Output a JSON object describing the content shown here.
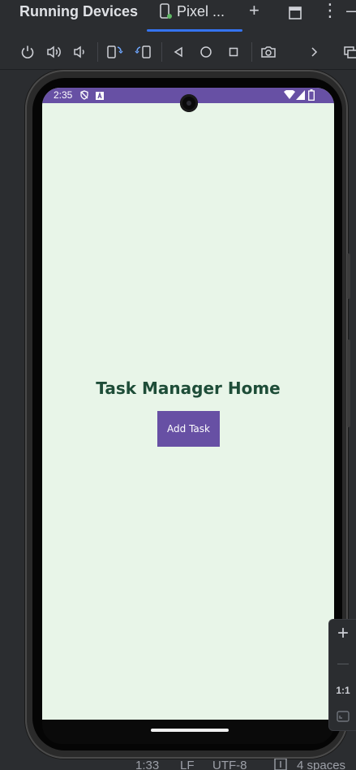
{
  "tool_window": {
    "title": "Running Devices",
    "device_tab": "Pixel ...",
    "add_tab_symbol": "+",
    "more_symbol": "⋮",
    "hide_symbol": "—"
  },
  "device_toolbar": {
    "icons": [
      "power-icon",
      "volume-up-icon",
      "volume-down-icon",
      "rotate-left-icon",
      "rotate-right-icon",
      "back-icon",
      "home-icon",
      "overview-icon",
      "screenshot-icon",
      "chevron-right-icon",
      "mirror-icon"
    ]
  },
  "device": {
    "status_bar": {
      "time": "2:35"
    },
    "app": {
      "title": "Task Manager Home",
      "add_button_label": "Add Task"
    }
  },
  "zoom_panel": {
    "zoom_in": "+",
    "zoom_out": "—",
    "actual_size": "1:1"
  },
  "status_line": {
    "cursor": "1:33",
    "line_ending": "LF",
    "encoding": "UTF-8",
    "indent": "4 spaces"
  },
  "colors": {
    "ide_background": "#2b2d30",
    "accent_blue": "#3574f0",
    "app_primary": "#6750a4",
    "app_background": "#e8f5e8",
    "app_title": "#1e4d38"
  }
}
